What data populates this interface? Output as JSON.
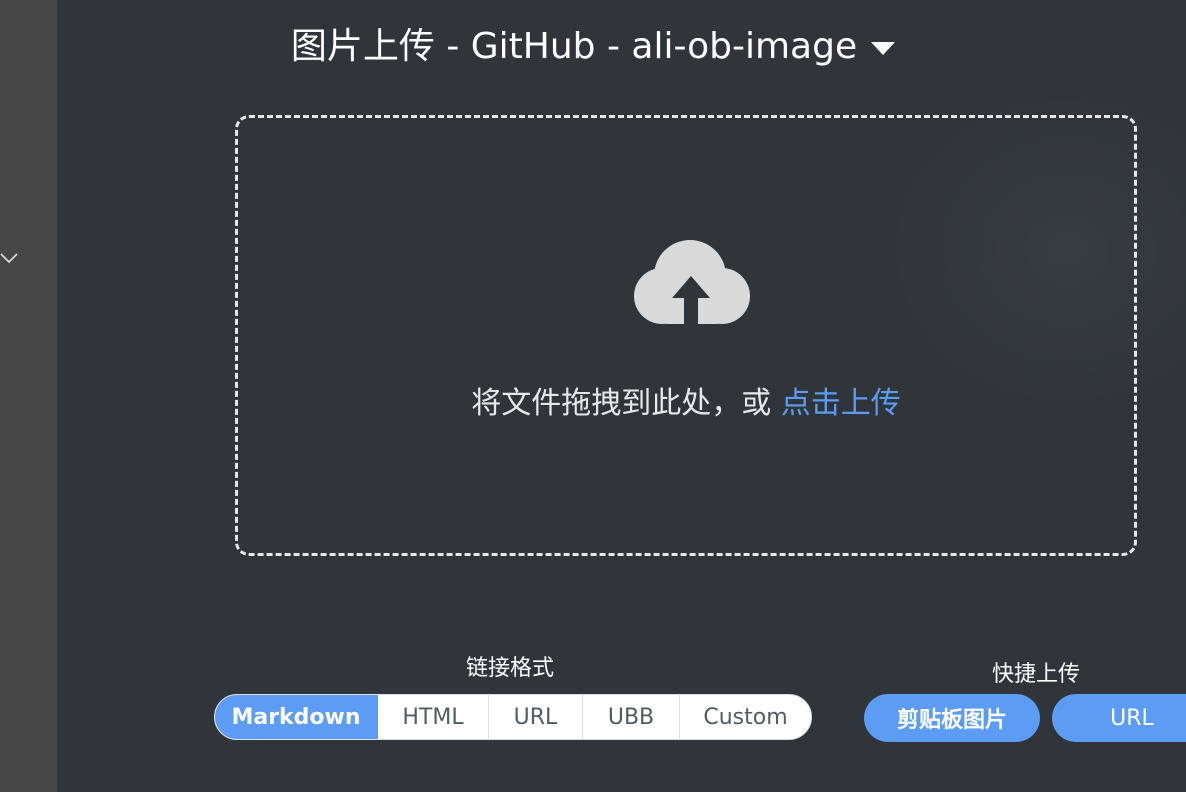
{
  "header": {
    "title": "图片上传 - GitHub - ali-ob-image"
  },
  "dropzone": {
    "text": "将文件拖拽到此处，或 ",
    "link": "点击上传"
  },
  "link_format": {
    "label": "链接格式",
    "options": [
      "Markdown",
      "HTML",
      "URL",
      "UBB",
      "Custom"
    ],
    "selected": "Markdown"
  },
  "quick_upload": {
    "label": "快捷上传",
    "clipboard_label": "剪贴板图片",
    "url_label": "URL"
  },
  "colors": {
    "accent": "#5c9cf5",
    "background": "#2f3538",
    "sidebar": "#474747"
  },
  "icons": {
    "upload": "cloud-upload-icon",
    "picbed_dropdown": "caret-down-icon",
    "sidebar_expand": "chevron-down-icon"
  }
}
